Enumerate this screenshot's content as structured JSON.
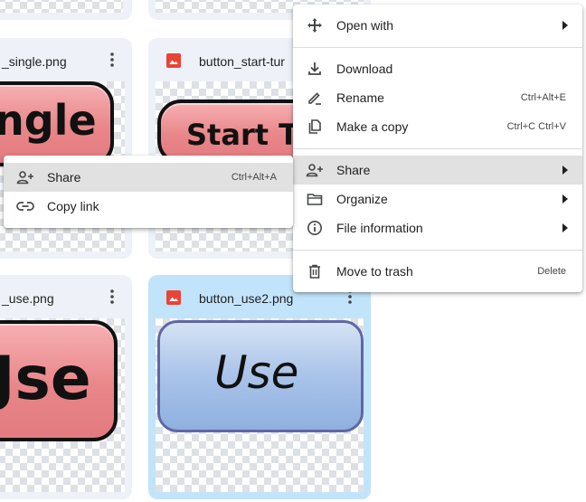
{
  "files": [
    {
      "name": "_single.png",
      "thumb_text": "ngle"
    },
    {
      "name": "button_start-tur",
      "thumb_text": "Start Tu"
    },
    {
      "name": "_use.png",
      "thumb_text": "Jse"
    },
    {
      "name": "button_use2.png",
      "thumb_text": "Use"
    }
  ],
  "context_menu": {
    "items": [
      {
        "label": "Open with",
        "icon": "open-with-icon",
        "submenu": true
      },
      {
        "label": "Download",
        "icon": "download-icon"
      },
      {
        "label": "Rename",
        "icon": "rename-icon",
        "shortcut": "Ctrl+Alt+E"
      },
      {
        "label": "Make a copy",
        "icon": "copy-icon",
        "shortcut": "Ctrl+C Ctrl+V"
      },
      {
        "label": "Share",
        "icon": "share-icon",
        "submenu": true,
        "highlighted": true
      },
      {
        "label": "Organize",
        "icon": "folder-icon",
        "submenu": true
      },
      {
        "label": "File information",
        "icon": "info-icon",
        "submenu": true
      },
      {
        "label": "Move to trash",
        "icon": "trash-icon",
        "shortcut": "Delete"
      }
    ]
  },
  "share_submenu": {
    "items": [
      {
        "label": "Share",
        "icon": "person-add-icon",
        "shortcut": "Ctrl+Alt+A",
        "highlighted": true
      },
      {
        "label": "Copy link",
        "icon": "link-icon"
      }
    ]
  },
  "colors": {
    "card_bg": "#eef2f8",
    "card_selected_bg": "#c2e4fb",
    "menu_highlight": "#e1e1e1",
    "image_file_icon": "#ea4335"
  }
}
